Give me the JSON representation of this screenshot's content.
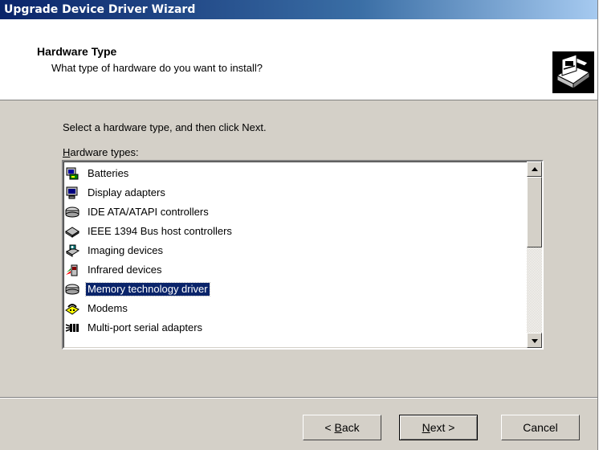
{
  "window": {
    "title": "Upgrade Device Driver Wizard"
  },
  "header": {
    "title": "Hardware Type",
    "subtitle": "What type of hardware do you want to install?",
    "icon": "hardware-install-icon"
  },
  "instructions": "Select a hardware type, and then click Next.",
  "list": {
    "label_accel": "H",
    "label_rest": "ardware types:",
    "items": [
      {
        "label": "Batteries",
        "icon": "battery-icon"
      },
      {
        "label": "Display adapters",
        "icon": "monitor-icon"
      },
      {
        "label": "IDE ATA/ATAPI controllers",
        "icon": "drive-icon"
      },
      {
        "label": "IEEE 1394 Bus host controllers",
        "icon": "bus-controller-icon"
      },
      {
        "label": "Imaging devices",
        "icon": "camera-icon"
      },
      {
        "label": "Infrared devices",
        "icon": "infrared-icon"
      },
      {
        "label": "Memory technology driver",
        "icon": "drive-icon",
        "selected": true
      },
      {
        "label": "Modems",
        "icon": "modem-icon"
      },
      {
        "label": "Multi-port serial adapters",
        "icon": "serial-port-icon"
      }
    ],
    "selected": "Memory technology driver"
  },
  "buttons": {
    "back_prefix": "< ",
    "back_accel": "B",
    "back_rest": "ack",
    "next_accel": "N",
    "next_rest": "ext >",
    "cancel": "Cancel"
  },
  "colors": {
    "selection": "#0a246a",
    "titlebar_start": "#0a246a",
    "dialog_face": "#d4d0c8"
  }
}
